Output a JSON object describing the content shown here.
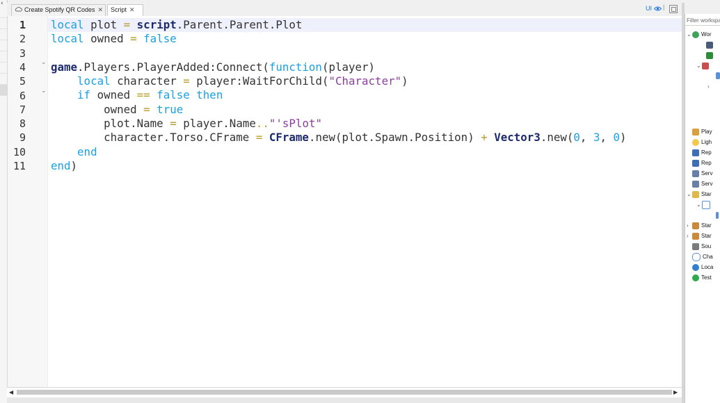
{
  "tabs": [
    {
      "label": "Create Spotify QR Codes",
      "close": "✕"
    },
    {
      "label": "Script",
      "close": "✕"
    }
  ],
  "toolbar_right": {
    "ui_label": "UI"
  },
  "editor": {
    "line_numbers": [
      "1",
      "2",
      "3",
      "4",
      "5",
      "6",
      "7",
      "8",
      "9",
      "10",
      "11"
    ]
  },
  "explorer": {
    "filter_placeholder": "Filter workspace",
    "items": [
      {
        "label": "Wor"
      },
      {
        "label": "Play"
      },
      {
        "label": "Ligh"
      },
      {
        "label": "Rep"
      },
      {
        "label": "Rep"
      },
      {
        "label": "Serv"
      },
      {
        "label": "Serv"
      },
      {
        "label": "Star"
      },
      {
        "label": "Star"
      },
      {
        "label": "Star"
      },
      {
        "label": "Sou"
      },
      {
        "label": "Cha"
      },
      {
        "label": "Loca"
      },
      {
        "label": "Test"
      }
    ]
  },
  "colors": {
    "keyword": "#1ba1e2",
    "global": "#1e2a6e",
    "operator": "#b69d2c",
    "string": "#8b3fa0",
    "current_line": "#eef0fb"
  }
}
